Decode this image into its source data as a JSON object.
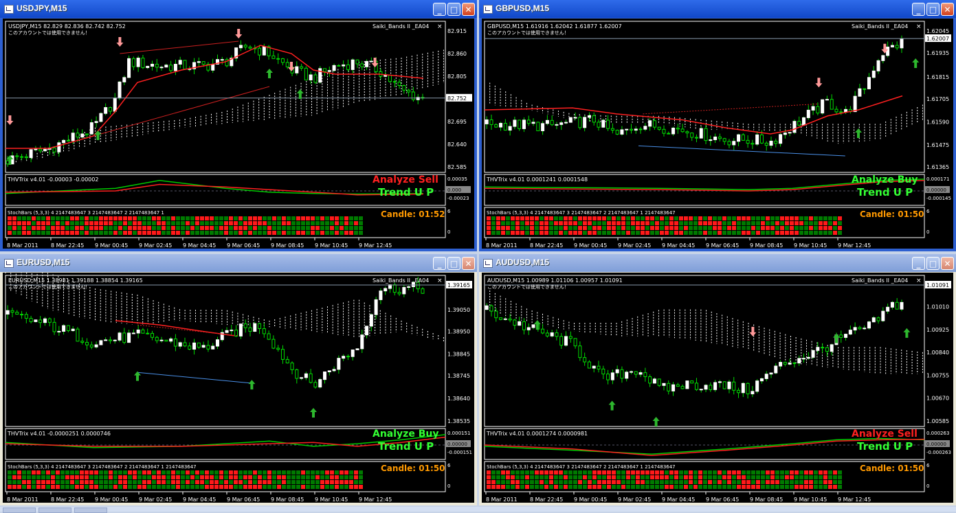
{
  "colors": {
    "bull": "#ffffff",
    "bear": "#00dd00",
    "cloud": "#ffffff",
    "arrow_up": "#2eb82e",
    "arrow_down": "#ff9999",
    "ema": "#ff2020",
    "trend": "#33ff33",
    "sell": "#ff2020",
    "candle": "#ff9900",
    "sb_red": "#ff1a1a",
    "sb_green": "#007a00"
  },
  "windows": [
    {
      "title": "USDJPY,M15",
      "info": "USDJPY,M15  82.829 82.836 82.742 82.752",
      "note": "このアカウントでは使用できません！",
      "ea": "Saiki_Bands II _EA04",
      "prices": [
        "82.915",
        "82.860",
        "82.805",
        "82.750",
        "82.695",
        "82.640",
        "82.585"
      ],
      "current": "82.752",
      "thv": "THVTrix v4.01 -0.00003 -0.00002",
      "thv_levels": [
        "0.00035",
        "0.000",
        "-0.00023"
      ],
      "thv_current": "0.000",
      "stoch": "StochBars (5,3,3) 4 2147483647 3 2147483647 2 2147483647 1",
      "stoch_scale": [
        "6",
        "0"
      ],
      "analyze": "Analyze Sell",
      "trend": "Trend U P",
      "candle": "Candle:  01:52",
      "times": [
        "8 Mar 2011",
        "8 Mar 22:45",
        "9 Mar 00:45",
        "9 Mar 02:45",
        "9 Mar 04:45",
        "9 Mar 06:45",
        "9 Mar 08:45",
        "9 Mar 10:45",
        "9 Mar 12:45"
      ]
    },
    {
      "title": "GBPUSD,M15",
      "info": "GBPUSD,M15  1.61916 1.62042 1.61877 1.62007",
      "note": "このアカウントでは使用できません！",
      "ea": "Saiki_Bands II _EA04",
      "prices": [
        "1.62045",
        "1.61935",
        "1.61815",
        "1.61705",
        "1.61590",
        "1.61475",
        "1.61365"
      ],
      "current": "1.62007",
      "thv": "THVTrix v4.01 0.0001241 0.0001548",
      "thv_levels": [
        "0.000171",
        "0.00000",
        "-0.000145"
      ],
      "thv_current": "0.00000",
      "stoch": "StochBars (5,3,3) 4 2147483647 3 2147483647 2 2147483647 1 2147483647",
      "stoch_scale": [
        "6",
        "0"
      ],
      "analyze": "Analyze Buy",
      "trend": "Trend U P",
      "candle": "Candle:  01:50",
      "times": [
        "8 Mar 2011",
        "8 Mar 22:45",
        "9 Mar 00:45",
        "9 Mar 02:45",
        "9 Mar 04:45",
        "9 Mar 06:45",
        "9 Mar 08:45",
        "9 Mar 10:45",
        "9 Mar 12:45"
      ]
    },
    {
      "title": "EURUSD,M15",
      "info": "EURUSD,M15  1.38981 1.39188 1.38854 1.39165",
      "note": "このアカウントでは使用できません！",
      "ea": "Saiki_Bands II _EA04",
      "prices": [
        "1.39165",
        "1.39050",
        "1.38950",
        "1.38845",
        "1.38745",
        "1.38640",
        "1.38535"
      ],
      "current": "1.39165",
      "thv": "THVTrix v4.01 -0.0000251 0.0000746",
      "thv_levels": [
        "0.000151",
        "0.00000",
        "-0.000151"
      ],
      "thv_current": "0.00000",
      "stoch": "StochBars (5,3,3) 4 2147483647 3 2147483647 2 2147483647 1 2147483647",
      "stoch_scale": [
        "6",
        "0"
      ],
      "analyze": "Analyze Buy",
      "trend": "Trend U P",
      "candle": "Candle:  01:50",
      "times": [
        "8 Mar 2011",
        "8 Mar 22:45",
        "9 Mar 00:45",
        "9 Mar 02:45",
        "9 Mar 04:45",
        "9 Mar 06:45",
        "9 Mar 08:45",
        "9 Mar 10:45",
        "9 Mar 12:45"
      ]
    },
    {
      "title": "AUDUSD,M15",
      "info": "AUDUSD,M15  1.00989 1.01106 1.00957 1.01091",
      "note": "このアカウントでは使用できません！",
      "ea": "Saiki_Bands II _EA04",
      "prices": [
        "1.01091",
        "1.01010",
        "1.00925",
        "1.00840",
        "1.00755",
        "1.00670",
        "1.00585"
      ],
      "current": "1.01091",
      "thv": "THVTrix v4.01 0.0001274 0.0000981",
      "thv_levels": [
        "0.000263",
        "0.00000",
        "-0.000263"
      ],
      "thv_current": "0.00000",
      "stoch": "StochBars (5,3,3) 4 2147483647 3 2147483647 2 2147483647 1 2147483647",
      "stoch_scale": [
        "6",
        "0"
      ],
      "analyze": "Analyze Sell",
      "trend": "Trend U P",
      "candle": "Candle:  01:50",
      "times": [
        "8 Mar 2011",
        "8 Mar 22:45",
        "9 Mar 00:45",
        "9 Mar 02:45",
        "9 Mar 04:45",
        "9 Mar 06:45",
        "9 Mar 08:45",
        "9 Mar 10:45",
        "9 Mar 12:45"
      ]
    }
  ],
  "series": [
    {
      "path": [
        [
          0,
          82.6
        ],
        [
          10,
          82.63
        ],
        [
          20,
          82.68
        ],
        [
          25,
          82.75
        ],
        [
          28,
          82.84
        ],
        [
          35,
          82.83
        ],
        [
          45,
          82.83
        ],
        [
          50,
          82.84
        ],
        [
          55,
          82.88
        ],
        [
          60,
          82.86
        ],
        [
          65,
          82.82
        ],
        [
          70,
          82.8
        ],
        [
          75,
          82.83
        ],
        [
          80,
          82.84
        ],
        [
          85,
          82.82
        ],
        [
          90,
          82.77
        ],
        [
          95,
          82.75
        ]
      ],
      "cloud": [
        [
          0,
          82.59,
          82.59
        ],
        [
          10,
          82.61,
          82.63
        ],
        [
          20,
          82.64,
          82.68
        ],
        [
          30,
          82.66,
          82.69
        ],
        [
          40,
          82.68,
          82.7
        ],
        [
          50,
          82.69,
          82.72
        ],
        [
          60,
          82.7,
          82.76
        ],
        [
          70,
          82.71,
          82.8
        ],
        [
          80,
          82.74,
          82.84
        ],
        [
          90,
          82.76,
          82.85
        ],
        [
          100,
          82.79,
          82.87
        ]
      ],
      "ema": [
        [
          0,
          82.63
        ],
        [
          10,
          82.63
        ],
        [
          20,
          82.66
        ],
        [
          25,
          82.72
        ],
        [
          30,
          82.79
        ],
        [
          40,
          82.82
        ],
        [
          50,
          82.84
        ],
        [
          58,
          82.88
        ],
        [
          65,
          82.86
        ],
        [
          70,
          82.82
        ],
        [
          75,
          82.81
        ],
        [
          85,
          82.81
        ],
        [
          95,
          82.8
        ]
      ],
      "thv_a": [
        [
          0,
          0.6
        ],
        [
          25,
          0.4
        ],
        [
          35,
          0.1
        ],
        [
          50,
          0.4
        ],
        [
          60,
          0.55
        ],
        [
          70,
          0.6
        ],
        [
          80,
          0.62
        ],
        [
          95,
          0.6
        ]
      ],
      "thv_b": [
        [
          0,
          0.55
        ],
        [
          25,
          0.5
        ],
        [
          35,
          0.25
        ],
        [
          50,
          0.35
        ],
        [
          60,
          0.45
        ],
        [
          70,
          0.55
        ],
        [
          80,
          0.65
        ],
        [
          95,
          0.62
        ]
      ],
      "up": [
        [
          1,
          82.6
        ],
        [
          21,
          82.66
        ],
        [
          67,
          82.76
        ],
        [
          60,
          82.81
        ]
      ],
      "down": [
        [
          1,
          82.7
        ],
        [
          26,
          82.89
        ],
        [
          53,
          82.91
        ],
        [
          65,
          82.83
        ],
        [
          84,
          82.84
        ]
      ],
      "stoch_red": [
        0.55,
        0.6,
        0.45,
        0.7,
        0.5,
        0.4
      ],
      "lows": [
        [
          20,
          82.66
        ],
        [
          60,
          82.78
        ]
      ],
      "highs": [
        [
          26,
          82.86
        ],
        [
          53,
          82.89
        ]
      ]
    },
    {
      "path": [
        [
          0,
          1.6158
        ],
        [
          15,
          1.6157
        ],
        [
          25,
          1.616
        ],
        [
          30,
          1.6152
        ],
        [
          35,
          1.6158
        ],
        [
          45,
          1.6155
        ],
        [
          55,
          1.615
        ],
        [
          60,
          1.615
        ],
        [
          65,
          1.6149
        ],
        [
          72,
          1.616
        ],
        [
          78,
          1.6169
        ],
        [
          82,
          1.6163
        ],
        [
          86,
          1.6175
        ],
        [
          90,
          1.6193
        ],
        [
          95,
          1.6199
        ]
      ],
      "cloud": [
        [
          0,
          1.6168,
          1.618
        ],
        [
          10,
          1.6165,
          1.6168
        ],
        [
          20,
          1.616,
          1.6163
        ],
        [
          30,
          1.6158,
          1.6162
        ],
        [
          40,
          1.6158,
          1.6162
        ],
        [
          50,
          1.6155,
          1.616
        ],
        [
          60,
          1.6155,
          1.6158
        ],
        [
          70,
          1.6154,
          1.6158
        ],
        [
          80,
          1.6148,
          1.6158
        ],
        [
          90,
          1.615,
          1.6158
        ],
        [
          100,
          1.616,
          1.6168
        ]
      ],
      "ema": [
        [
          0,
          1.6165
        ],
        [
          20,
          1.6166
        ],
        [
          30,
          1.6163
        ],
        [
          45,
          1.616
        ],
        [
          55,
          1.6156
        ],
        [
          65,
          1.6153
        ],
        [
          70,
          1.6155
        ],
        [
          78,
          1.6162
        ],
        [
          85,
          1.6165
        ],
        [
          95,
          1.6172
        ]
      ],
      "thv_a": [
        [
          0,
          0.35
        ],
        [
          40,
          0.4
        ],
        [
          60,
          0.45
        ],
        [
          70,
          0.4
        ],
        [
          80,
          0.25
        ],
        [
          90,
          0.1
        ],
        [
          100,
          0.05
        ]
      ],
      "thv_b": [
        [
          0,
          0.4
        ],
        [
          40,
          0.45
        ],
        [
          60,
          0.5
        ],
        [
          70,
          0.45
        ],
        [
          80,
          0.3
        ],
        [
          90,
          0.15
        ],
        [
          100,
          0.1
        ]
      ],
      "up": [
        [
          85,
          1.6153
        ],
        [
          98,
          1.6188
        ]
      ],
      "down": [
        [
          76,
          1.6179
        ],
        [
          91,
          1.6196
        ]
      ],
      "stoch_red": [
        0.6,
        0.5,
        0.55,
        0.45,
        0.4,
        0.3
      ],
      "lows": [
        [
          35,
          1.6147
        ],
        [
          82,
          1.6142
        ]
      ],
      "highs": [
        [
          36,
          1.6163
        ],
        [
          76,
          1.6168
        ]
      ]
    },
    {
      "path": [
        [
          0,
          1.3903
        ],
        [
          10,
          1.3898
        ],
        [
          20,
          1.389
        ],
        [
          30,
          1.3893
        ],
        [
          38,
          1.389
        ],
        [
          45,
          1.3887
        ],
        [
          52,
          1.3895
        ],
        [
          58,
          1.3898
        ],
        [
          65,
          1.3878
        ],
        [
          70,
          1.387
        ],
        [
          75,
          1.388
        ],
        [
          80,
          1.3888
        ],
        [
          85,
          1.3915
        ]
      ],
      "cloud": [
        [
          0,
          1.3915,
          1.3925
        ],
        [
          10,
          1.3905,
          1.3922
        ],
        [
          20,
          1.39,
          1.3915
        ],
        [
          30,
          1.3898,
          1.3912
        ],
        [
          40,
          1.39,
          1.3905
        ],
        [
          50,
          1.3898,
          1.3905
        ],
        [
          60,
          1.3897,
          1.39
        ],
        [
          70,
          1.3895,
          1.3905
        ],
        [
          80,
          1.3892,
          1.391
        ],
        [
          90,
          1.3895,
          1.39
        ],
        [
          100,
          1.389,
          1.3892
        ]
      ],
      "ema": [
        [
          25,
          1.39
        ],
        [
          35,
          1.3898
        ],
        [
          45,
          1.3895
        ],
        [
          52,
          1.3893
        ]
      ],
      "thv_a": [
        [
          0,
          0.4
        ],
        [
          20,
          0.6
        ],
        [
          40,
          0.55
        ],
        [
          60,
          0.35
        ],
        [
          70,
          0.55
        ],
        [
          80,
          0.45
        ],
        [
          90,
          0.3
        ],
        [
          100,
          0.1
        ]
      ],
      "thv_b": [
        [
          0,
          0.45
        ],
        [
          20,
          0.55
        ],
        [
          40,
          0.55
        ],
        [
          60,
          0.45
        ],
        [
          70,
          0.4
        ],
        [
          80,
          0.55
        ],
        [
          90,
          0.4
        ],
        [
          100,
          0.2
        ]
      ],
      "up": [
        [
          30,
          1.3874
        ],
        [
          56,
          1.387
        ],
        [
          70,
          1.3857
        ]
      ],
      "down": [],
      "stoch_red": [
        0.5,
        0.55,
        0.45,
        0.6,
        0.4,
        0.5
      ],
      "lows": [
        [
          30,
          1.3876
        ],
        [
          56,
          1.3871
        ]
      ],
      "highs": [
        [
          30,
          1.3898
        ],
        [
          53,
          1.3893
        ]
      ]
    },
    {
      "path": [
        [
          0,
          1.01
        ],
        [
          10,
          1.0093
        ],
        [
          20,
          1.0087
        ],
        [
          27,
          1.0074
        ],
        [
          35,
          1.0078
        ],
        [
          40,
          1.007
        ],
        [
          45,
          1.0072
        ],
        [
          52,
          1.0072
        ],
        [
          60,
          1.007
        ],
        [
          68,
          1.008
        ],
        [
          75,
          1.0084
        ],
        [
          82,
          1.009
        ],
        [
          88,
          1.0094
        ],
        [
          93,
          1.0102
        ]
      ],
      "cloud": [
        [
          0,
          1.01,
          1.0108
        ],
        [
          10,
          1.0095,
          1.01
        ],
        [
          20,
          1.0092,
          1.0095
        ],
        [
          30,
          1.009,
          1.0095
        ],
        [
          40,
          1.009,
          1.01
        ],
        [
          50,
          1.0088,
          1.01
        ],
        [
          60,
          1.0085,
          1.0095
        ],
        [
          70,
          1.008,
          1.009
        ],
        [
          80,
          1.0078,
          1.0086
        ],
        [
          90,
          1.0076,
          1.0086
        ],
        [
          100,
          1.0076,
          1.0084
        ]
      ],
      "ema": [],
      "thv_a": [
        [
          0,
          0.55
        ],
        [
          20,
          0.7
        ],
        [
          38,
          0.85
        ],
        [
          55,
          0.65
        ],
        [
          70,
          0.45
        ],
        [
          80,
          0.3
        ],
        [
          90,
          0.25
        ],
        [
          100,
          0.3
        ]
      ],
      "thv_b": [
        [
          0,
          0.5
        ],
        [
          20,
          0.65
        ],
        [
          38,
          0.9
        ],
        [
          55,
          0.7
        ],
        [
          70,
          0.5
        ],
        [
          80,
          0.35
        ],
        [
          90,
          0.3
        ],
        [
          100,
          0.28
        ]
      ],
      "up": [
        [
          12,
          1.0094
        ],
        [
          29,
          1.0064
        ],
        [
          39,
          1.0058
        ],
        [
          80,
          1.0089
        ],
        [
          96,
          1.0091
        ]
      ],
      "down": [
        [
          61,
          1.0092
        ]
      ],
      "stoch_red": [
        0.5,
        0.45,
        0.55,
        0.4,
        0.5,
        0.45
      ],
      "lows": [],
      "highs": []
    }
  ]
}
